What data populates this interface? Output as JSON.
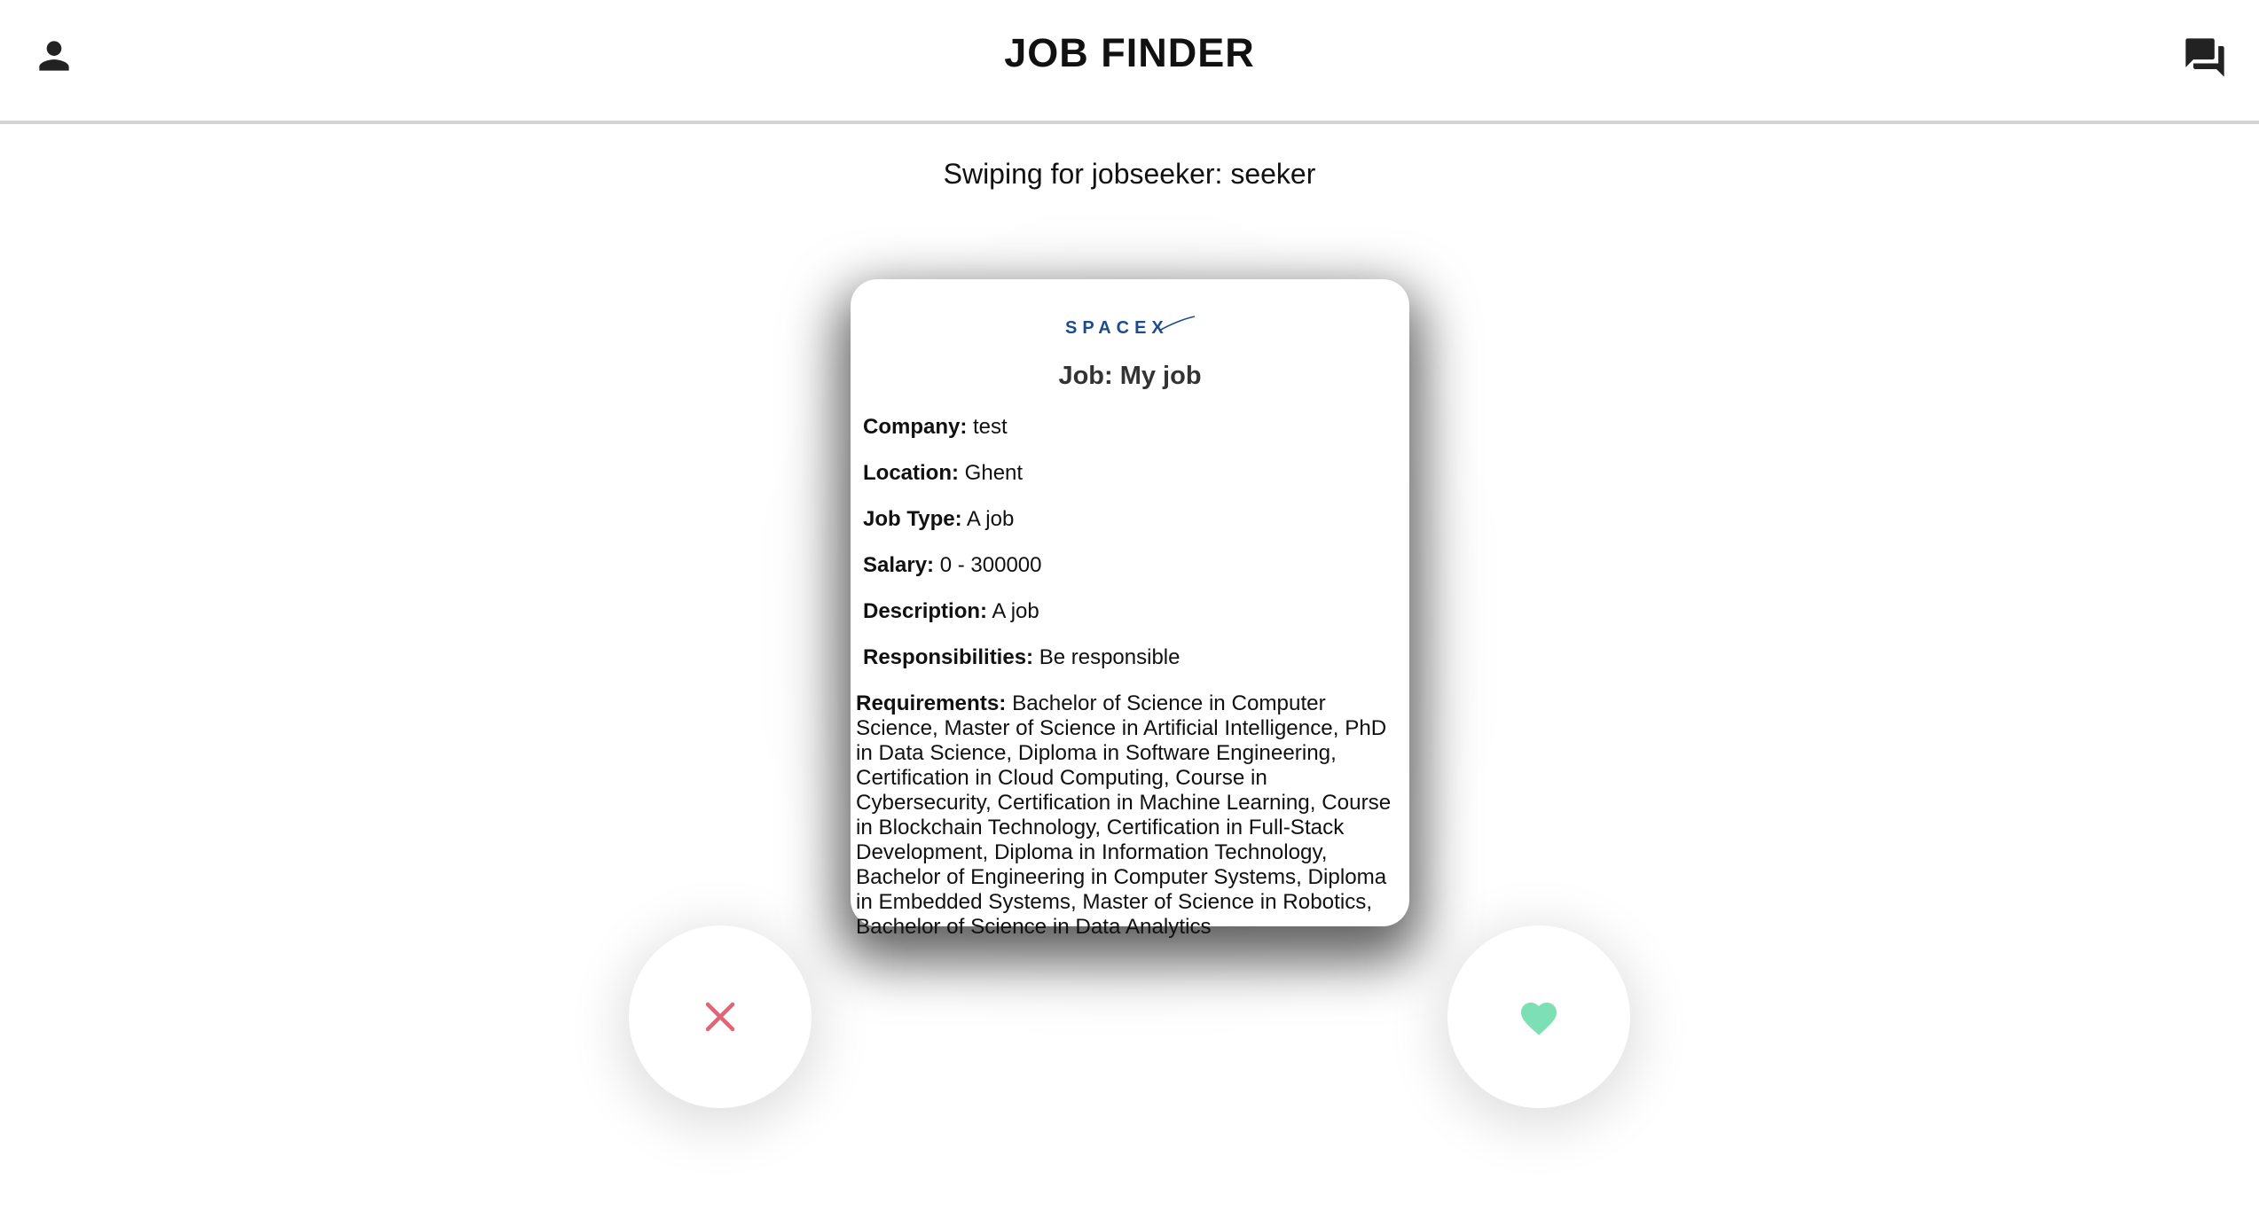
{
  "app": {
    "title": "JOB FINDER"
  },
  "header": {
    "profile_icon": "person-icon",
    "chat_icon": "chat-forum-icon"
  },
  "subtitle": "Swiping for jobseeker: seeker",
  "card": {
    "logo_text": "SPACEX",
    "job_title": "Job: My job",
    "company_label": "Company:",
    "company_value": "test",
    "location_label": "Location:",
    "location_value": "Ghent",
    "job_type_label": "Job Type:",
    "job_type_value": "A job",
    "salary_label": "Salary:",
    "salary_value": "0 - 300000",
    "description_label": "Description:",
    "description_value": "A job",
    "responsibilities_label": "Responsibilities:",
    "responsibilities_value": "Be responsible",
    "requirements_label": "Requirements:",
    "requirements_value": "Bachelor of Science in Computer Science, Master of Science in Artificial Intelligence, PhD in Data Science, Diploma in Software Engineering, Certification in Cloud Computing, Course in Cybersecurity, Certification in Machine Learning, Course in Blockchain Technology, Certification in Full-Stack Development, Diploma in Information Technology, Bachelor of Engineering in Computer Systems, Diploma in Embedded Systems, Master of Science in Robotics, Bachelor of Science in Data Analytics"
  },
  "actions": {
    "reject_icon": "close-icon",
    "like_icon": "heart-icon"
  },
  "colors": {
    "reject": "#e06675",
    "like": "#7ddfb6",
    "logo": "#1e4b8c",
    "header_border": "#d4d4d4"
  }
}
